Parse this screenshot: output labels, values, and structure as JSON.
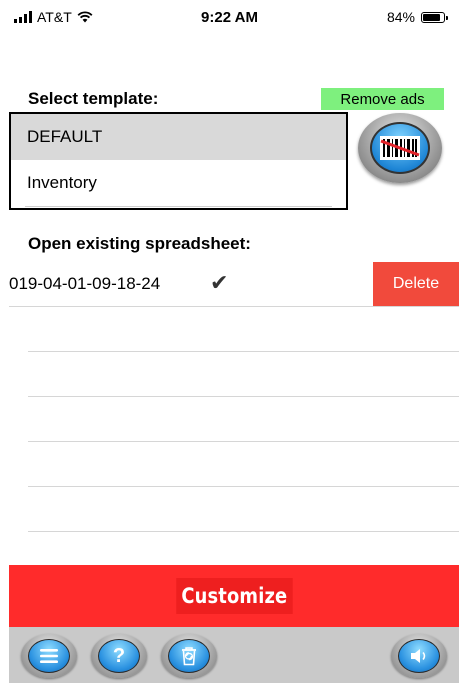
{
  "status_bar": {
    "carrier": "AT&T",
    "time": "9:22 AM",
    "battery": "84%",
    "battery_level": 0.84
  },
  "template_section": {
    "title": "Select template:",
    "remove_ads_label": "Remove ads",
    "options": [
      "DEFAULT",
      "Inventory"
    ],
    "selected": "DEFAULT"
  },
  "spreadsheet_section": {
    "title": "Open existing spreadsheet:",
    "files": [
      {
        "name": "019-04-01-09-18-24",
        "checked": true,
        "delete_label": "Delete"
      }
    ]
  },
  "customize_label": "Customize",
  "colors": {
    "accent_red": "#ff2b2b",
    "delete_red": "#f14a3c",
    "remove_ads_green": "#7ef07e",
    "button_blue": "#2a91e0"
  },
  "toolbar": {
    "icons": [
      "menu-icon",
      "help-icon",
      "trash-icon",
      "speaker-icon"
    ]
  }
}
